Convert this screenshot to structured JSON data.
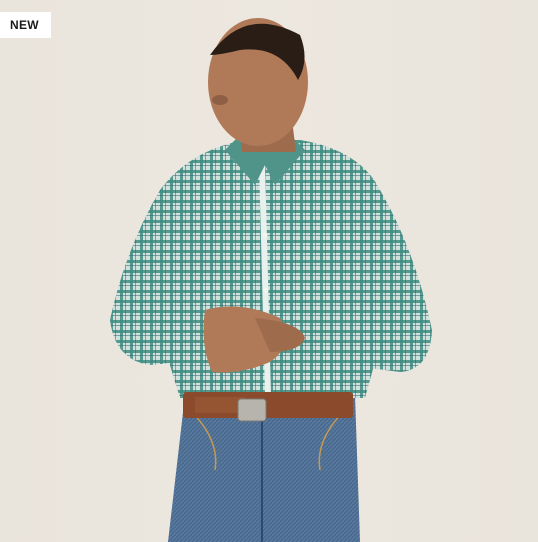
{
  "product": {
    "badge": "NEW",
    "image_subject": "model-wearing-green-plaid-shirt",
    "colors": {
      "background": "#ebe6de",
      "shirt": "#5f9d92",
      "denim": "#3f5f86",
      "belt": "#8a4a2b"
    }
  }
}
